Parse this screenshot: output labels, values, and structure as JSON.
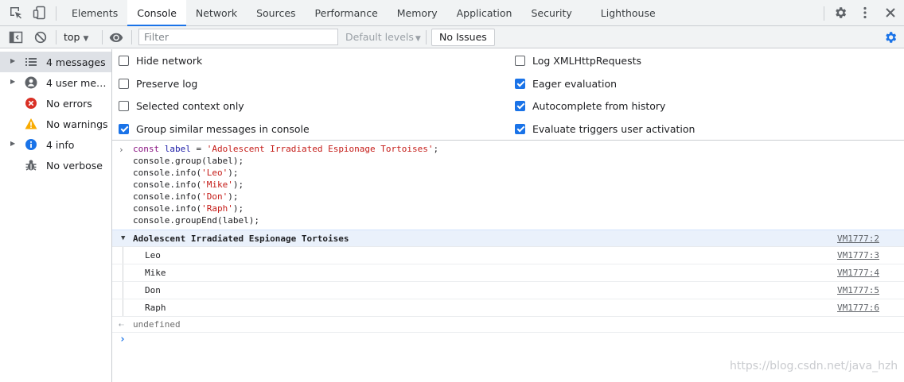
{
  "tabbar": {
    "tabs": [
      "Elements",
      "Console",
      "Network",
      "Sources",
      "Performance",
      "Memory",
      "Application",
      "Security",
      "Lighthouse"
    ],
    "active_tab": "Console"
  },
  "toolbar": {
    "context": "top",
    "filter_placeholder": "Filter",
    "levels": "Default levels",
    "issues": "No Issues"
  },
  "sidebar": {
    "items": [
      {
        "label": "4 messages",
        "icon": "list-icon"
      },
      {
        "label": "4 user messages",
        "icon": "user-icon"
      },
      {
        "label": "No errors",
        "icon": "error-icon"
      },
      {
        "label": "No warnings",
        "icon": "warning-icon"
      },
      {
        "label": "4 info",
        "icon": "info-icon"
      },
      {
        "label": "No verbose",
        "icon": "bug-icon"
      }
    ]
  },
  "settings": {
    "left": [
      {
        "label": "Hide network",
        "checked": false
      },
      {
        "label": "Preserve log",
        "checked": false
      },
      {
        "label": "Selected context only",
        "checked": false
      },
      {
        "label": "Group similar messages in console",
        "checked": true
      }
    ],
    "right": [
      {
        "label": "Log XMLHttpRequests",
        "checked": false
      },
      {
        "label": "Eager evaluation",
        "checked": true
      },
      {
        "label": "Autocomplete from history",
        "checked": true
      },
      {
        "label": "Evaluate triggers user activation",
        "checked": true
      }
    ]
  },
  "code": {
    "kw": "const",
    "var": "label",
    "eq": " = ",
    "str": "'Adolescent Irradiated Espionage Tortoises'",
    "semi": ";",
    "lines": [
      {
        "pre": "console.group(label);",
        "str": "",
        "post": ""
      },
      {
        "pre": "console.info(",
        "str": "'Leo'",
        "post": ");"
      },
      {
        "pre": "console.info(",
        "str": "'Mike'",
        "post": ");"
      },
      {
        "pre": "console.info(",
        "str": "'Don'",
        "post": ");"
      },
      {
        "pre": "console.info(",
        "str": "'Raph'",
        "post": ");"
      },
      {
        "pre": "console.groupEnd(label);",
        "str": "",
        "post": ""
      }
    ]
  },
  "output": {
    "group_title": "Adolescent Irradiated Espionage Tortoises",
    "group_link": "VM1777:2",
    "items": [
      {
        "text": "Leo",
        "link": "VM1777:3"
      },
      {
        "text": "Mike",
        "link": "VM1777:4"
      },
      {
        "text": "Don",
        "link": "VM1777:5"
      },
      {
        "text": "Raph",
        "link": "VM1777:6"
      }
    ],
    "result": "undefined"
  },
  "watermark": "https://blog.csdn.net/java_hzh",
  "colors": {
    "accent": "#1a73e8",
    "error": "#d93025",
    "warning": "#f9ab00"
  }
}
